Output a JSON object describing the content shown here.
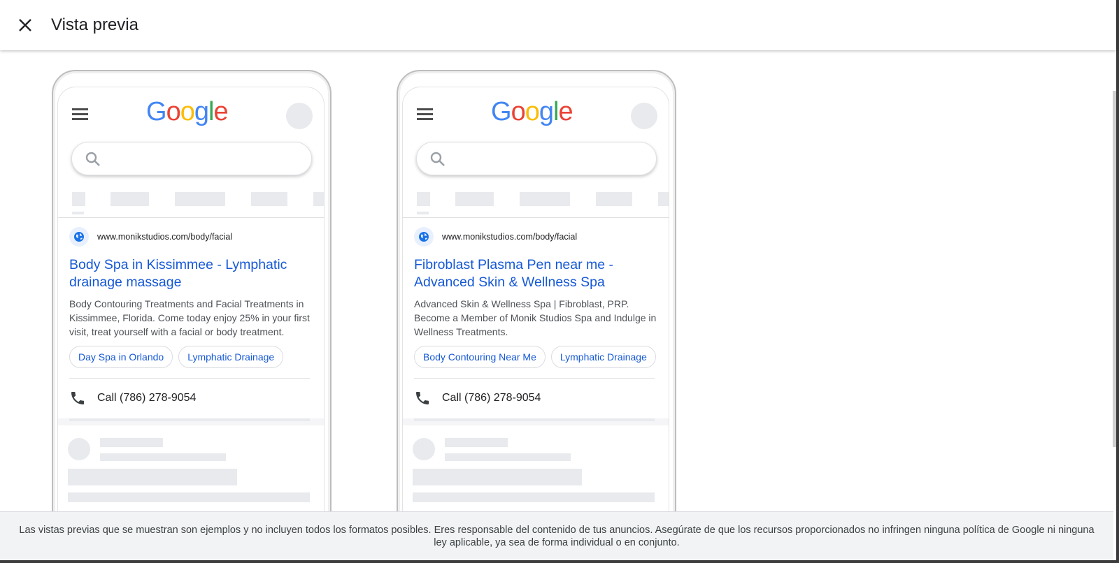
{
  "header": {
    "close_icon": "close-icon",
    "title": "Vista previa"
  },
  "previews": [
    {
      "logo": [
        "G",
        "o",
        "o",
        "g",
        "l",
        "e"
      ],
      "url": "www.monikstudios.com/body/facial",
      "title": "Body Spa in Kissimmee - Lymphatic drainage massage",
      "description": "Body Contouring Treatments and Facial Treatments in Kissimmee, Florida. Come today enjoy 25% in your first visit, treat yourself with a facial or body treatment.",
      "sitelinks": [
        "Day Spa in Orlando",
        "Lymphatic Drainage"
      ],
      "call": "Call (786) 278-9054"
    },
    {
      "logo": [
        "G",
        "o",
        "o",
        "g",
        "l",
        "e"
      ],
      "url": "www.monikstudios.com/body/facial",
      "title": "Fibroblast Plasma Pen near me - Advanced Skin & Wellness Spa",
      "description": "Advanced Skin & Wellness Spa | Fibroblast, PRP. Become a Member of Monik Studios Spa and Indulge in Wellness Treatments.",
      "sitelinks": [
        "Body Contouring Near Me",
        "Lymphatic Drainage"
      ],
      "call": "Call (786) 278-9054"
    }
  ],
  "footer": {
    "disclaimer": "Las vistas previas que se muestran son ejemplos y no incluyen todos los formatos posibles. Eres responsable del contenido de tus anuncios. Asegúrate de que los recursos proporcionados no infringen ninguna política de Google ni ninguna ley aplicable, ya sea de forma individual o en conjunto."
  },
  "colors": {
    "link": "#1558d6",
    "google_blue": "#4285f4",
    "google_red": "#ea4335",
    "google_yellow": "#fbbc05",
    "google_green": "#34a853",
    "skeleton": "#e8eaed"
  }
}
